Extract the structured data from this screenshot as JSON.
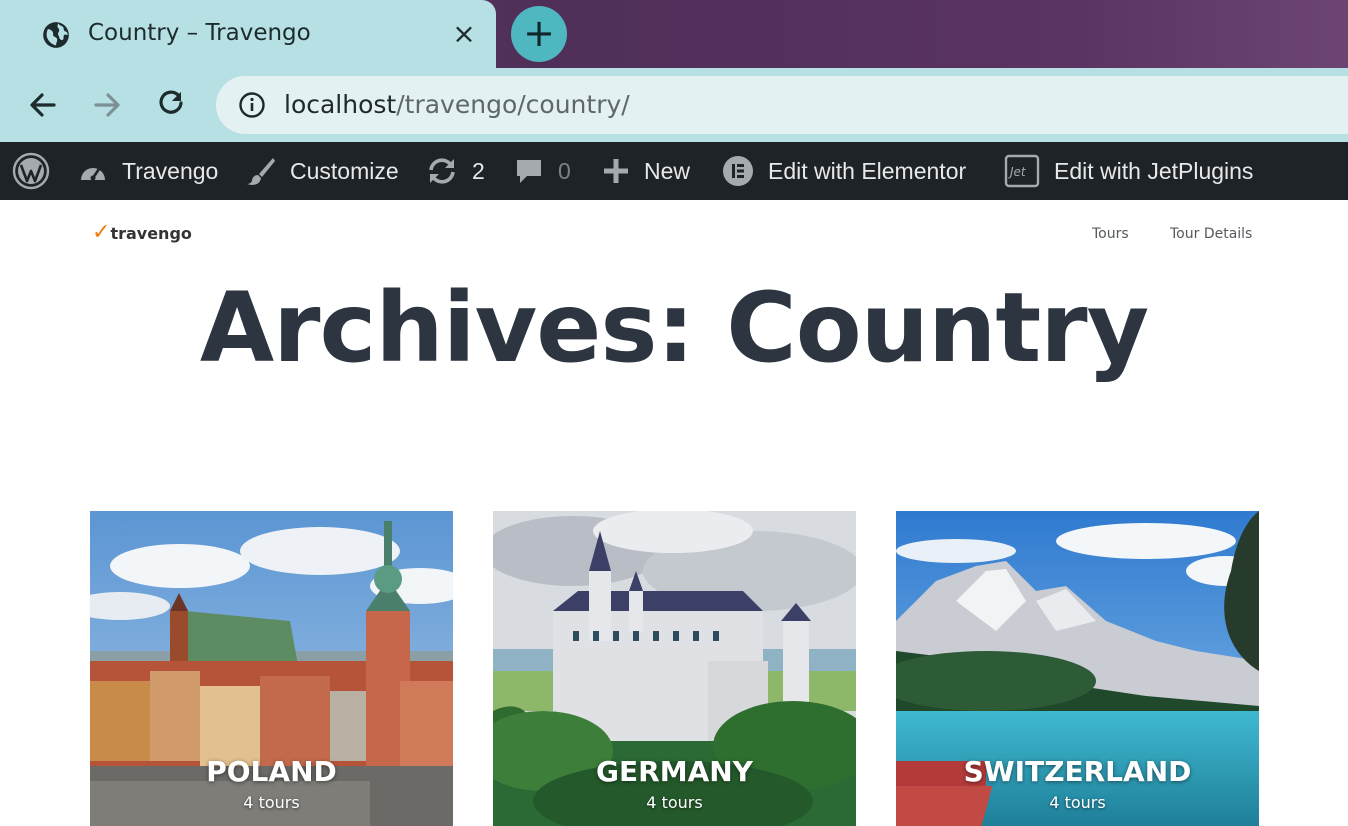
{
  "browser": {
    "tab_title": "Country – Travengo",
    "tab_close": "×",
    "new_tab": "+",
    "url_host": "localhost",
    "url_path": "/travengo/country/",
    "theme_colors": {
      "tab": "#b6e0e4",
      "frame": "#4f2f58",
      "omnibox": "#e4f1f2"
    }
  },
  "admin_bar": {
    "site_name": "Travengo",
    "customize": "Customize",
    "updates_count": "2",
    "comments_count": "0",
    "new": "New",
    "edit_elementor": "Edit with Elementor",
    "edit_jetplugins": "Edit with JetPlugins"
  },
  "site": {
    "logo_text": "travengo",
    "logo_mark": "✓",
    "nav": [
      "Tours",
      "Tour Details"
    ],
    "accent_color": "#f07b11"
  },
  "page": {
    "title": "Archives: Country"
  },
  "countries": [
    {
      "name": "POLAND",
      "count": "4 tours"
    },
    {
      "name": "GERMANY",
      "count": "4 tours"
    },
    {
      "name": "SWITZERLAND",
      "count": "4 tours"
    }
  ]
}
